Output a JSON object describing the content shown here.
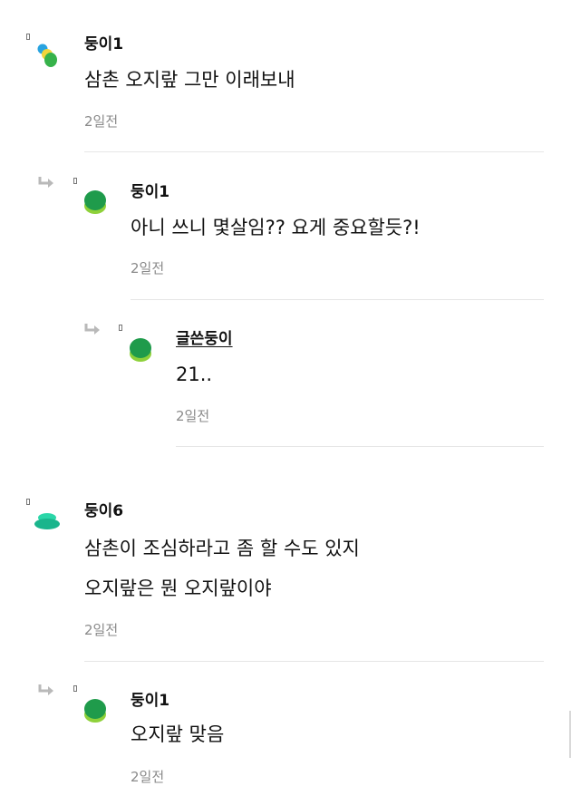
{
  "comments": [
    {
      "name": "둥이1",
      "lines": [
        "삼촌 오지랖 그만 이래보내"
      ],
      "time": "2일전"
    },
    {
      "name": "둥이1",
      "lines": [
        "아니 쓰니 몇살임?? 요게 중요할듯?!"
      ],
      "time": "2일전"
    },
    {
      "name": "글쓴둥이",
      "lines": [
        "21.."
      ],
      "time": "2일전"
    },
    {
      "name": "둥이6",
      "lines": [
        "삼촌이 조심하라고 좀 할 수도 있지",
        "오지랖은 뭔 오지랖이야"
      ],
      "time": "2일전"
    },
    {
      "name": "둥이1",
      "lines": [
        "오지랖 맞음"
      ],
      "time": "2일전"
    }
  ],
  "icons": {
    "reply": "reply-arrow-icon",
    "tiny": "report-flag-icon",
    "avatars": [
      "avatar-multicolor",
      "avatar-green",
      "avatar-green",
      "avatar-teal-stack",
      "avatar-green"
    ]
  }
}
